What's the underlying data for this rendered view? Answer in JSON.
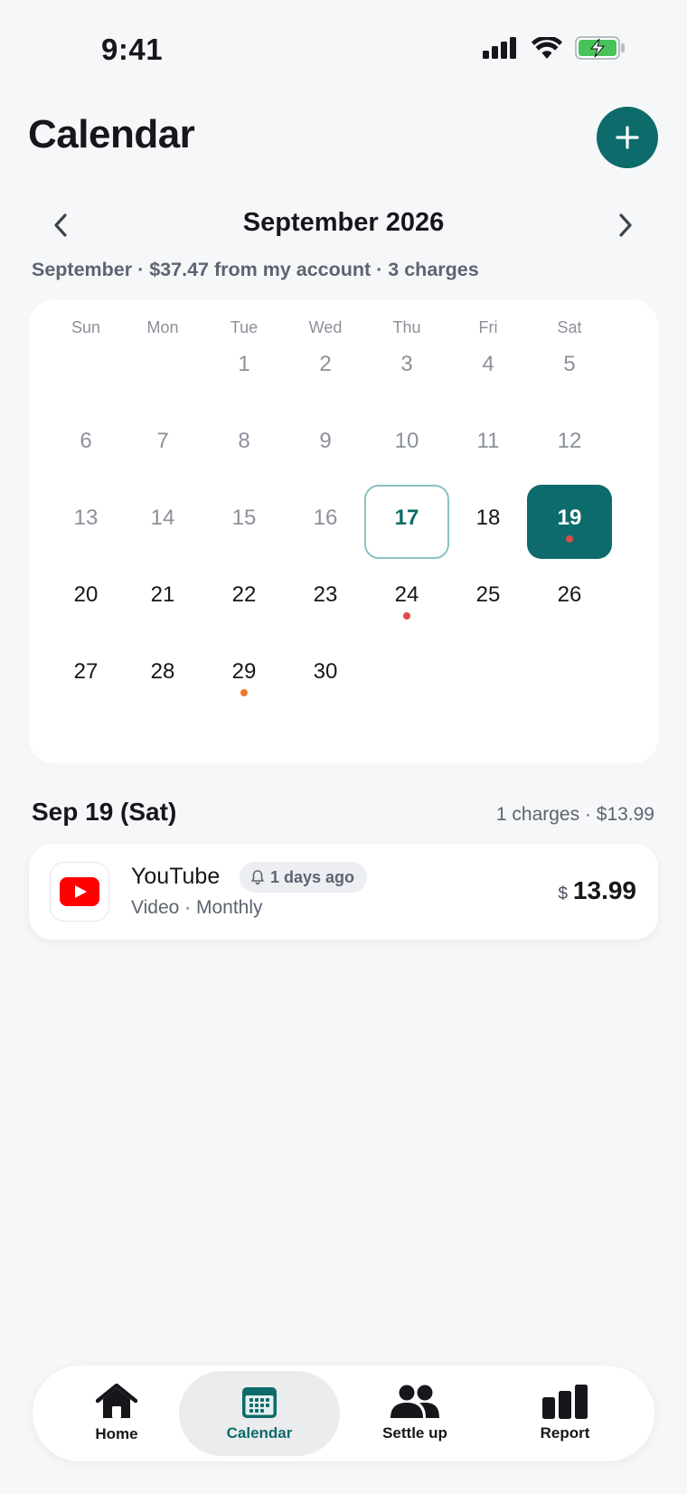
{
  "status_bar": {
    "time": "9:41"
  },
  "header": {
    "title": "Calendar",
    "add_button_label": "+"
  },
  "month_nav": {
    "month_title": "September 2026",
    "summary": "September · $37.47 from my account · 3 charges"
  },
  "calendar": {
    "weekdays": [
      "Sun",
      "Mon",
      "Tue",
      "Wed",
      "Thu",
      "Fri",
      "Sat"
    ],
    "weeks": [
      [
        "",
        "",
        "1",
        "2",
        "3",
        "4",
        "5"
      ],
      [
        "6",
        "7",
        "8",
        "9",
        "10",
        "11",
        "12"
      ],
      [
        "13",
        "14",
        "15",
        "16",
        "17",
        "18",
        "19"
      ],
      [
        "20",
        "21",
        "22",
        "23",
        "24",
        "25",
        "26"
      ],
      [
        "27",
        "28",
        "29",
        "30",
        "",
        "",
        ""
      ]
    ],
    "today": "17",
    "selected": "19",
    "charge_dots": {
      "19": "#e04a4a",
      "24": "#e04a4a",
      "29": "#ef7a2a"
    },
    "accent_color": "#0d6b6b"
  },
  "selected_day": {
    "title": "Sep 19 (Sat)",
    "summary": "1 charges · $13.99",
    "charges": [
      {
        "name": "YouTube",
        "reminder": "1 days ago",
        "subtitle": "Video · Monthly",
        "currency": "$",
        "amount": "13.99",
        "icon": "youtube-logo-icon"
      }
    ]
  },
  "tabbar": {
    "tabs": [
      {
        "label": "Home",
        "icon": "home-icon",
        "active": false
      },
      {
        "label": "Calendar",
        "icon": "calendar-icon",
        "active": true
      },
      {
        "label": "Settle up",
        "icon": "people-icon",
        "active": false
      },
      {
        "label": "Report",
        "icon": "bar-chart-icon",
        "active": false
      }
    ]
  }
}
